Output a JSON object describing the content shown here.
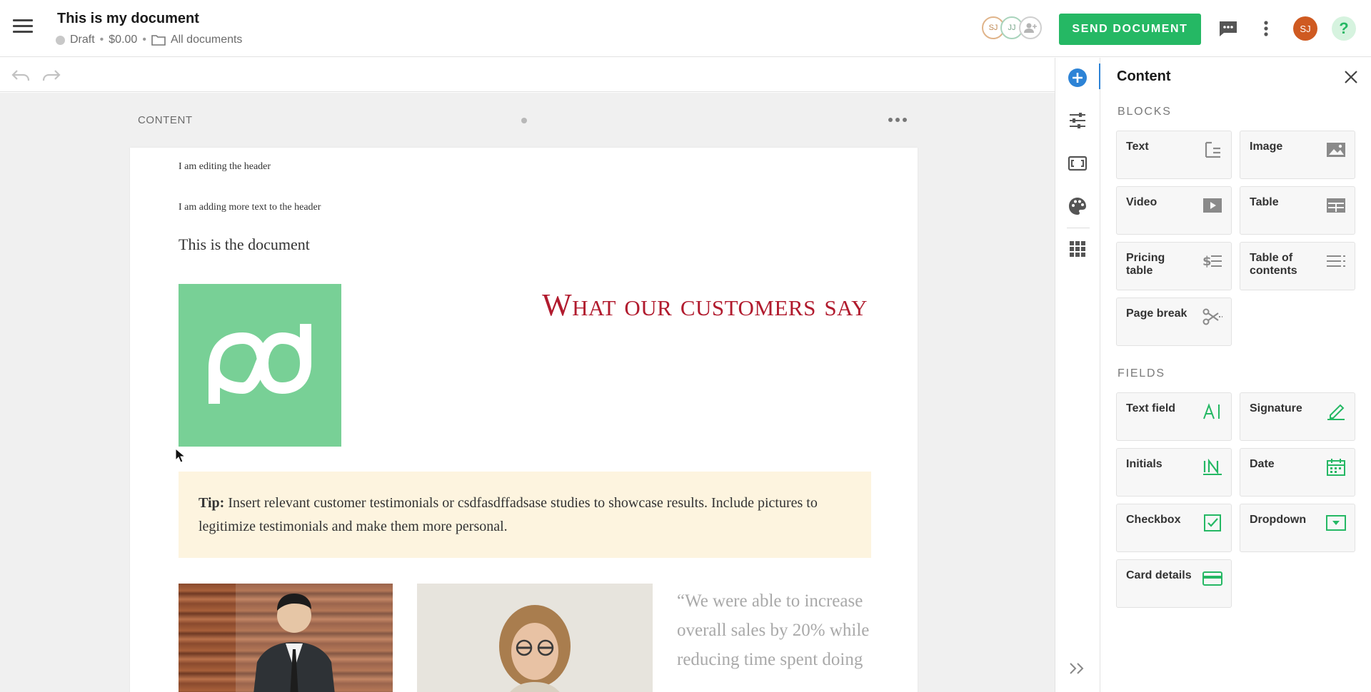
{
  "header": {
    "title": "This is my document",
    "status": "Draft",
    "price": "$0.00",
    "folder": "All documents",
    "collaborators": [
      "SJ",
      "JJ"
    ],
    "send_label": "SEND DOCUMENT",
    "user_initials": "SJ",
    "help_label": "?"
  },
  "canvas": {
    "section_label": "CONTENT",
    "header_line_1": "I am editing the header",
    "header_line_2": "I am adding more text to the header",
    "doc_heading": "This is the document",
    "testimonials_title": "What our customers say",
    "tip_label": "Tip:",
    "tip_text": " Insert relevant customer testimonials or csdfasdffadsase studies to showcase results. Include pictures to legitimize testimonials and make them more personal.",
    "quote": "“We were able to increase overall sales by 20% while reducing time spent doing"
  },
  "panel": {
    "title": "Content",
    "blocks_label": "BLOCKS",
    "fields_label": "FIELDS",
    "blocks": [
      {
        "label": "Text",
        "icon": "text-block-icon"
      },
      {
        "label": "Image",
        "icon": "image-block-icon"
      },
      {
        "label": "Video",
        "icon": "video-block-icon"
      },
      {
        "label": "Table",
        "icon": "table-block-icon"
      },
      {
        "label": "Pricing table",
        "icon": "pricing-table-icon"
      },
      {
        "label": "Table of contents",
        "icon": "table-of-contents-icon"
      },
      {
        "label": "Page break",
        "icon": "page-break-icon"
      }
    ],
    "fields": [
      {
        "label": "Text field",
        "icon": "text-field-icon"
      },
      {
        "label": "Signature",
        "icon": "signature-icon"
      },
      {
        "label": "Initials",
        "icon": "initials-icon"
      },
      {
        "label": "Date",
        "icon": "date-icon"
      },
      {
        "label": "Checkbox",
        "icon": "checkbox-icon"
      },
      {
        "label": "Dropdown",
        "icon": "dropdown-icon"
      },
      {
        "label": "Card details",
        "icon": "card-details-icon"
      }
    ]
  },
  "colors": {
    "accent_green": "#25b864",
    "logo_green": "#78d096",
    "title_red": "#b11b2e",
    "rail_blue": "#2d83d6",
    "tip_background": "#fdf4df",
    "user_avatar": "#cf5a21"
  }
}
